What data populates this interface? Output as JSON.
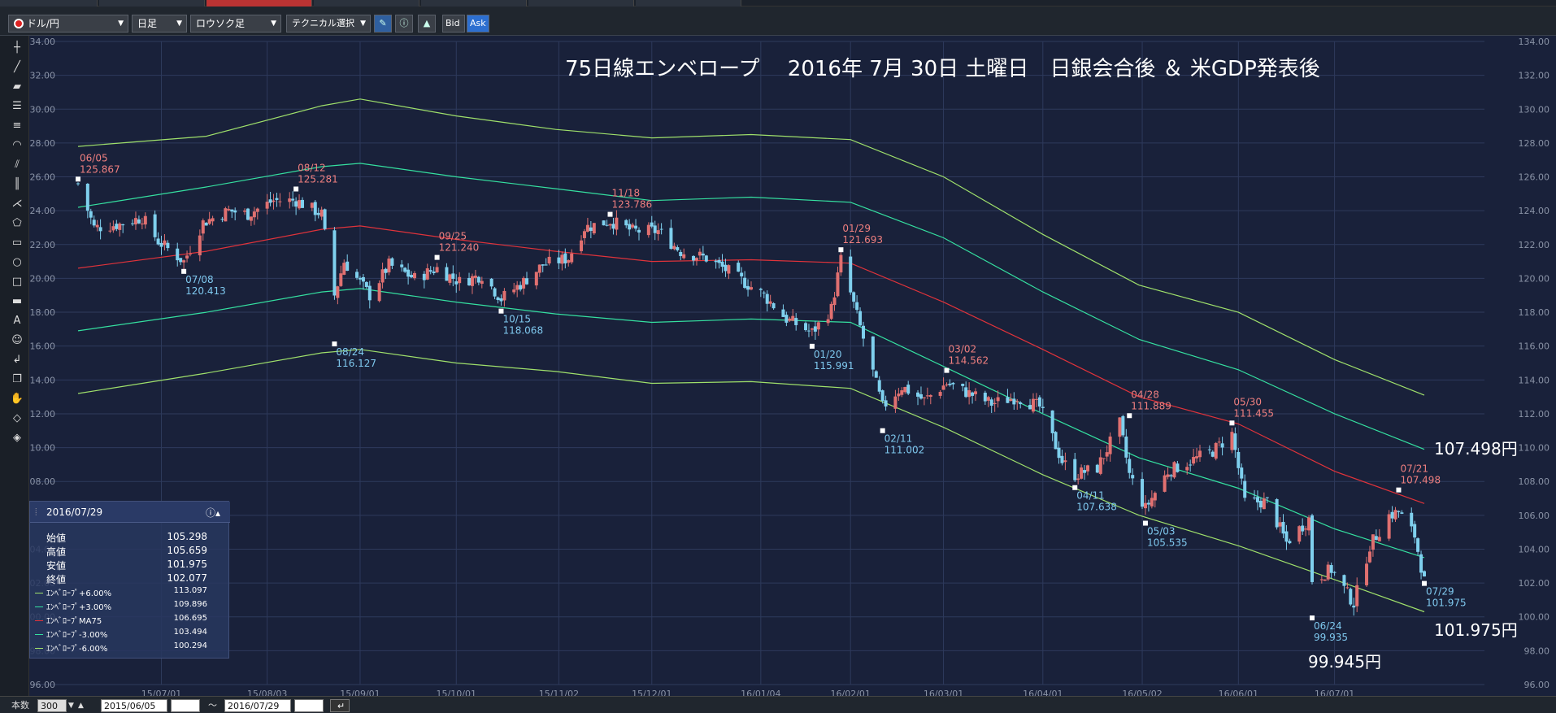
{
  "toolbar": {
    "symbol": "ドル/円",
    "period": "日足",
    "chart_style": "ロウソク足",
    "technical": "テクニカル選択",
    "bid": "Bid",
    "ask": "Ask"
  },
  "footer": {
    "count_label": "本数",
    "count_value": "300",
    "date_from": "2015/06/05",
    "tilde": "〜",
    "date_to": "2016/07/29"
  },
  "info": {
    "date": "2016/07/29",
    "rows": [
      {
        "k": "始値",
        "v": "105.298"
      },
      {
        "k": "高値",
        "v": "105.659"
      },
      {
        "k": "安値",
        "v": "101.975"
      },
      {
        "k": "終値",
        "v": "102.077"
      }
    ],
    "env_rows": [
      {
        "k": "ｴﾝﾍﾞﾛｰﾌﾟ+6.00%",
        "v": "113.097",
        "color": "#9fe06b"
      },
      {
        "k": "ｴﾝﾍﾞﾛｰﾌﾟ+3.00%",
        "v": "109.896",
        "color": "#35e0a0"
      },
      {
        "k": "ｴﾝﾍﾞﾛｰﾌﾟMA75",
        "v": "106.695",
        "color": "#e0333a"
      },
      {
        "k": "ｴﾝﾍﾞﾛｰﾌﾟ-3.00%",
        "v": "103.494",
        "color": "#35e0a0"
      },
      {
        "k": "ｴﾝﾍﾞﾛｰﾌﾟ-6.00%",
        "v": "100.294",
        "color": "#9fe06b"
      }
    ]
  },
  "overlay": {
    "title": "75日線エンベロープ　 2016年 7月 30日 土曜日　日銀会合後 ＆ 米GDP発表後",
    "upper_note": "107.498円",
    "last_note": "101.975円",
    "low_note": "99.945円"
  },
  "chart_data": {
    "type": "candlestick",
    "ylim": [
      96,
      134
    ],
    "y_ticks": [
      "134.00",
      "132.00",
      "130.00",
      "128.00",
      "126.00",
      "124.00",
      "122.00",
      "120.00",
      "118.00",
      "116.00",
      "114.00",
      "112.00",
      "110.00",
      "108.00",
      "106.00",
      "104.00",
      "102.00",
      "100.00",
      "98.00",
      "96.00"
    ],
    "x_ticks": [
      {
        "date": "2015-07-01",
        "label": "15/07/01"
      },
      {
        "date": "2015-08-03",
        "label": "15/08/03"
      },
      {
        "date": "2015-09-01",
        "label": "15/09/01"
      },
      {
        "date": "2015-10-01",
        "label": "15/10/01"
      },
      {
        "date": "2015-11-02",
        "label": "15/11/02"
      },
      {
        "date": "2015-12-01",
        "label": "15/12/01"
      },
      {
        "date": "2016-01-04",
        "label": "16/01/04"
      },
      {
        "date": "2016-02-01",
        "label": "16/02/01"
      },
      {
        "date": "2016-03-01",
        "label": "16/03/01"
      },
      {
        "date": "2016-04-01",
        "label": "16/04/01"
      },
      {
        "date": "2016-05-02",
        "label": "16/05/02"
      },
      {
        "date": "2016-06-01",
        "label": "16/06/01"
      },
      {
        "date": "2016-07-01",
        "label": "16/07/01"
      }
    ],
    "x_range": [
      "2015-06-05",
      "2016-07-29"
    ],
    "price_path": [
      [
        "2015-06-05",
        125.6
      ],
      [
        "2015-06-10",
        123.0
      ],
      [
        "2015-06-18",
        123.2
      ],
      [
        "2015-06-25",
        123.6
      ],
      [
        "2015-06-30",
        122.2
      ],
      [
        "2015-07-08",
        121.0
      ],
      [
        "2015-07-14",
        123.3
      ],
      [
        "2015-07-22",
        124.0
      ],
      [
        "2015-07-28",
        123.8
      ],
      [
        "2015-08-05",
        124.6
      ],
      [
        "2015-08-12",
        124.6
      ],
      [
        "2015-08-20",
        123.8
      ],
      [
        "2015-08-24",
        119.0
      ],
      [
        "2015-08-27",
        121.0
      ],
      [
        "2015-09-04",
        119.0
      ],
      [
        "2015-09-10",
        120.8
      ],
      [
        "2015-09-18",
        120.0
      ],
      [
        "2015-09-25",
        120.6
      ],
      [
        "2015-10-02",
        119.8
      ],
      [
        "2015-10-09",
        120.2
      ],
      [
        "2015-10-15",
        118.8
      ],
      [
        "2015-10-22",
        119.8
      ],
      [
        "2015-10-28",
        120.8
      ],
      [
        "2015-11-05",
        121.2
      ],
      [
        "2015-11-10",
        123.0
      ],
      [
        "2015-11-18",
        123.4
      ],
      [
        "2015-11-25",
        122.8
      ],
      [
        "2015-12-03",
        122.8
      ],
      [
        "2015-12-10",
        121.6
      ],
      [
        "2015-12-18",
        121.2
      ],
      [
        "2015-12-25",
        120.4
      ],
      [
        "2016-01-05",
        119.0
      ],
      [
        "2016-01-12",
        117.6
      ],
      [
        "2016-01-20",
        116.8
      ],
      [
        "2016-01-26",
        118.2
      ],
      [
        "2016-01-29",
        121.1
      ],
      [
        "2016-02-03",
        117.8
      ],
      [
        "2016-02-11",
        112.4
      ],
      [
        "2016-02-17",
        113.6
      ],
      [
        "2016-02-24",
        112.8
      ],
      [
        "2016-03-02",
        113.8
      ],
      [
        "2016-03-09",
        113.2
      ],
      [
        "2016-03-16",
        112.6
      ],
      [
        "2016-03-24",
        113.0
      ],
      [
        "2016-03-31",
        112.4
      ],
      [
        "2016-04-07",
        109.2
      ],
      [
        "2016-04-11",
        108.4
      ],
      [
        "2016-04-18",
        108.8
      ],
      [
        "2016-04-25",
        111.4
      ],
      [
        "2016-04-28",
        108.4
      ],
      [
        "2016-05-03",
        106.4
      ],
      [
        "2016-05-10",
        108.6
      ],
      [
        "2016-05-17",
        109.2
      ],
      [
        "2016-05-24",
        109.8
      ],
      [
        "2016-05-30",
        110.8
      ],
      [
        "2016-06-03",
        106.8
      ],
      [
        "2016-06-10",
        106.8
      ],
      [
        "2016-06-16",
        104.4
      ],
      [
        "2016-06-23",
        105.8
      ],
      [
        "2016-06-24",
        102.2
      ],
      [
        "2016-06-30",
        102.8
      ],
      [
        "2016-07-07",
        100.8
      ],
      [
        "2016-07-12",
        104.2
      ],
      [
        "2016-07-18",
        106.0
      ],
      [
        "2016-07-21",
        106.2
      ],
      [
        "2016-07-26",
        104.8
      ],
      [
        "2016-07-29",
        102.1
      ]
    ],
    "series": [
      {
        "name": "ｴﾝﾍﾞﾛｰﾌﾟ+6.00%",
        "color": "#9fe06b",
        "values": [
          [
            "2015-06-05",
            127.8
          ],
          [
            "2015-07-15",
            128.4
          ],
          [
            "2015-08-20",
            130.2
          ],
          [
            "2015-09-01",
            130.6
          ],
          [
            "2015-10-01",
            129.6
          ],
          [
            "2015-11-01",
            128.8
          ],
          [
            "2015-12-01",
            128.3
          ],
          [
            "2016-01-01",
            128.5
          ],
          [
            "2016-02-01",
            128.2
          ],
          [
            "2016-03-01",
            126.0
          ],
          [
            "2016-04-01",
            122.6
          ],
          [
            "2016-05-01",
            119.6
          ],
          [
            "2016-06-01",
            118.0
          ],
          [
            "2016-07-01",
            115.2
          ],
          [
            "2016-07-29",
            113.1
          ]
        ]
      },
      {
        "name": "ｴﾝﾍﾞﾛｰﾌﾟ+3.00%",
        "color": "#35e0a0",
        "values": [
          [
            "2015-06-05",
            124.2
          ],
          [
            "2015-07-15",
            125.4
          ],
          [
            "2015-08-20",
            126.6
          ],
          [
            "2015-09-01",
            126.8
          ],
          [
            "2015-10-01",
            126.0
          ],
          [
            "2015-11-01",
            125.3
          ],
          [
            "2015-12-01",
            124.6
          ],
          [
            "2016-01-01",
            124.8
          ],
          [
            "2016-02-01",
            124.5
          ],
          [
            "2016-03-01",
            122.4
          ],
          [
            "2016-04-01",
            119.2
          ],
          [
            "2016-05-01",
            116.4
          ],
          [
            "2016-06-01",
            114.6
          ],
          [
            "2016-07-01",
            112.0
          ],
          [
            "2016-07-29",
            109.9
          ]
        ]
      },
      {
        "name": "ｴﾝﾍﾞﾛｰﾌﾟMA75",
        "color": "#e0333a",
        "values": [
          [
            "2015-06-05",
            120.6
          ],
          [
            "2015-07-15",
            121.6
          ],
          [
            "2015-08-20",
            122.9
          ],
          [
            "2015-09-01",
            123.1
          ],
          [
            "2015-10-01",
            122.3
          ],
          [
            "2015-11-01",
            121.6
          ],
          [
            "2015-12-01",
            121.0
          ],
          [
            "2016-01-01",
            121.1
          ],
          [
            "2016-02-01",
            120.9
          ],
          [
            "2016-03-01",
            118.6
          ],
          [
            "2016-04-01",
            115.8
          ],
          [
            "2016-05-01",
            113.0
          ],
          [
            "2016-06-01",
            111.4
          ],
          [
            "2016-07-01",
            108.6
          ],
          [
            "2016-07-29",
            106.7
          ]
        ]
      },
      {
        "name": "ｴﾝﾍﾞﾛｰﾌﾟ-3.00%",
        "color": "#35e0a0",
        "values": [
          [
            "2015-06-05",
            116.9
          ],
          [
            "2015-07-15",
            118.0
          ],
          [
            "2015-08-20",
            119.2
          ],
          [
            "2015-09-01",
            119.4
          ],
          [
            "2015-10-01",
            118.6
          ],
          [
            "2015-11-01",
            117.9
          ],
          [
            "2015-12-01",
            117.4
          ],
          [
            "2016-01-01",
            117.6
          ],
          [
            "2016-02-01",
            117.4
          ],
          [
            "2016-03-01",
            114.8
          ],
          [
            "2016-04-01",
            112.0
          ],
          [
            "2016-05-01",
            109.4
          ],
          [
            "2016-06-01",
            107.6
          ],
          [
            "2016-07-01",
            105.2
          ],
          [
            "2016-07-29",
            103.5
          ]
        ]
      },
      {
        "name": "ｴﾝﾍﾞﾛｰﾌﾟ-6.00%",
        "color": "#9fe06b",
        "values": [
          [
            "2015-06-05",
            113.2
          ],
          [
            "2015-07-15",
            114.4
          ],
          [
            "2015-08-20",
            115.6
          ],
          [
            "2015-09-01",
            115.8
          ],
          [
            "2015-10-01",
            115.0
          ],
          [
            "2015-11-01",
            114.5
          ],
          [
            "2015-12-01",
            113.8
          ],
          [
            "2016-01-01",
            113.9
          ],
          [
            "2016-02-01",
            113.5
          ],
          [
            "2016-03-01",
            111.2
          ],
          [
            "2016-04-01",
            108.4
          ],
          [
            "2016-05-01",
            106.0
          ],
          [
            "2016-06-01",
            104.2
          ],
          [
            "2016-07-01",
            102.2
          ],
          [
            "2016-07-29",
            100.3
          ]
        ]
      }
    ],
    "annotations": [
      {
        "date": "06/05",
        "value": "125.867",
        "kind": "high",
        "d": "2015-06-05",
        "y": 125.867
      },
      {
        "date": "08/12",
        "value": "125.281",
        "kind": "high",
        "d": "2015-08-12",
        "y": 125.281
      },
      {
        "date": "09/25",
        "value": "121.240",
        "kind": "high",
        "d": "2015-09-25",
        "y": 121.24
      },
      {
        "date": "11/18",
        "value": "123.786",
        "kind": "high",
        "d": "2015-11-18",
        "y": 123.786
      },
      {
        "date": "01/29",
        "value": "121.693",
        "kind": "high",
        "d": "2016-01-29",
        "y": 121.693
      },
      {
        "date": "03/02",
        "value": "114.562",
        "kind": "high",
        "d": "2016-03-02",
        "y": 114.562
      },
      {
        "date": "04/28",
        "value": "111.889",
        "kind": "high",
        "d": "2016-04-28",
        "y": 111.889
      },
      {
        "date": "05/30",
        "value": "111.455",
        "kind": "high",
        "d": "2016-05-30",
        "y": 111.455
      },
      {
        "date": "07/21",
        "value": "107.498",
        "kind": "high",
        "d": "2016-07-21",
        "y": 107.498
      },
      {
        "date": "07/08",
        "value": "120.413",
        "kind": "low",
        "d": "2015-07-08",
        "y": 120.413
      },
      {
        "date": "08/24",
        "value": "116.127",
        "kind": "low",
        "d": "2015-08-24",
        "y": 116.127
      },
      {
        "date": "10/15",
        "value": "118.068",
        "kind": "low",
        "d": "2015-10-15",
        "y": 118.068
      },
      {
        "date": "01/20",
        "value": "115.991",
        "kind": "low",
        "d": "2016-01-20",
        "y": 115.991
      },
      {
        "date": "02/11",
        "value": "111.002",
        "kind": "low",
        "d": "2016-02-11",
        "y": 111.002
      },
      {
        "date": "04/11",
        "value": "107.638",
        "kind": "low",
        "d": "2016-04-11",
        "y": 107.638
      },
      {
        "date": "05/03",
        "value": "105.535",
        "kind": "low",
        "d": "2016-05-03",
        "y": 105.535
      },
      {
        "date": "06/24",
        "value": "99.935",
        "kind": "low",
        "d": "2016-06-24",
        "y": 99.935
      },
      {
        "date": "07/29",
        "value": "101.975",
        "kind": "low",
        "d": "2016-07-29",
        "y": 101.975
      }
    ],
    "colors": {
      "up": "#e07070",
      "down": "#7fd0ee",
      "grid": "#2e3a5c",
      "axis_text": "#8a93a6",
      "high_label": "#ef7f7f",
      "low_label": "#7fc9ef"
    }
  }
}
